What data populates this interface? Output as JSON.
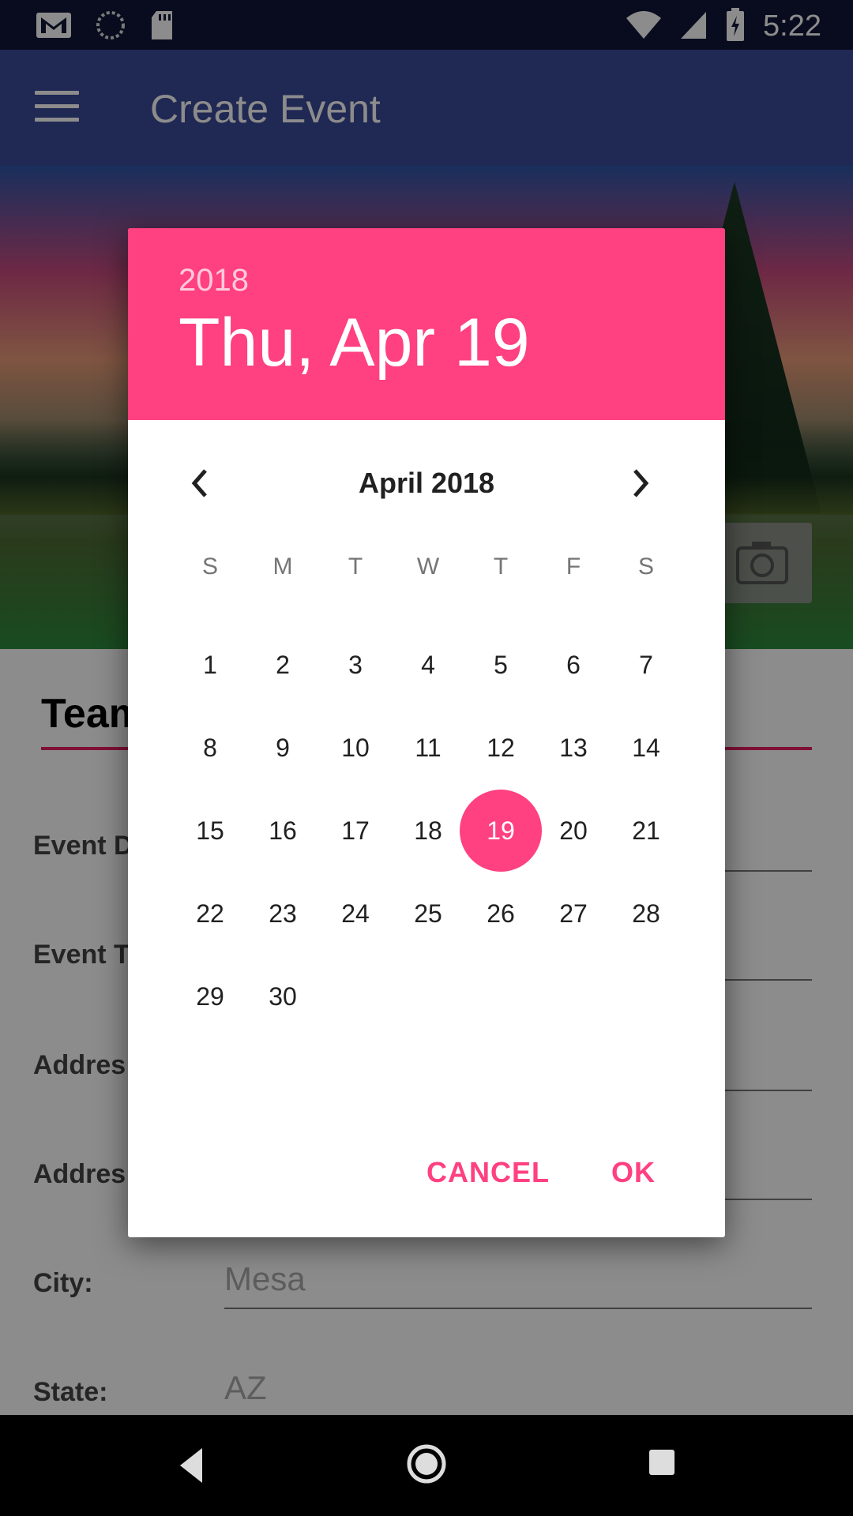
{
  "status_bar": {
    "time": "5:22",
    "left_icons": [
      "gmail-icon",
      "sync-icon",
      "sd-card-icon"
    ],
    "right_icons": [
      "wifi-icon",
      "signal-icon",
      "battery-charging-icon"
    ]
  },
  "app_bar": {
    "title": "Create Event",
    "menu_icon": "hamburger-menu-icon"
  },
  "form": {
    "team_name_value": "Team",
    "rows": [
      {
        "label": "Event D",
        "value": ""
      },
      {
        "label": "Event T",
        "value": ""
      },
      {
        "label": "Addres",
        "value": ""
      },
      {
        "label": "Addres",
        "value": ""
      },
      {
        "label": "City:",
        "value": "Mesa"
      },
      {
        "label": "State:",
        "value": "AZ"
      }
    ]
  },
  "date_picker": {
    "header_year": "2018",
    "header_date": "Thu, Apr 19",
    "month_label": "April 2018",
    "weekdays": [
      "S",
      "M",
      "T",
      "W",
      "T",
      "F",
      "S"
    ],
    "first_weekday_index": 0,
    "days_in_month": 30,
    "selected_day": 19,
    "cancel_label": "CANCEL",
    "ok_label": "OK",
    "accent_color": "#ff4081"
  },
  "nav_bar": {
    "icons": [
      "back-icon",
      "home-icon",
      "recents-icon"
    ]
  }
}
